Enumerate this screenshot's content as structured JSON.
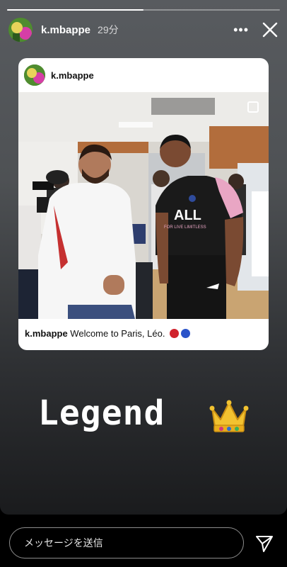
{
  "story": {
    "progress": 0.5,
    "username": "k.mbappe",
    "time": "29分",
    "more_icon": "more-horizontal-icon",
    "close_icon": "close-icon"
  },
  "post": {
    "username": "k.mbappe",
    "caption_user": "k.mbappe",
    "caption_text": " Welcome to Paris, Léo. ",
    "shirt_text": "ALL",
    "shirt_subtext": "FOR LIVE LIMITLESS",
    "emoji": [
      "red-circle",
      "blue-circle"
    ]
  },
  "overlay": {
    "text": "Legend",
    "sticker": "crown-icon"
  },
  "footer": {
    "message_placeholder": "メッセージを送信",
    "send_icon": "send-icon"
  },
  "colors": {
    "red_dot": "#d0222c",
    "blue_dot": "#2a53c9"
  }
}
